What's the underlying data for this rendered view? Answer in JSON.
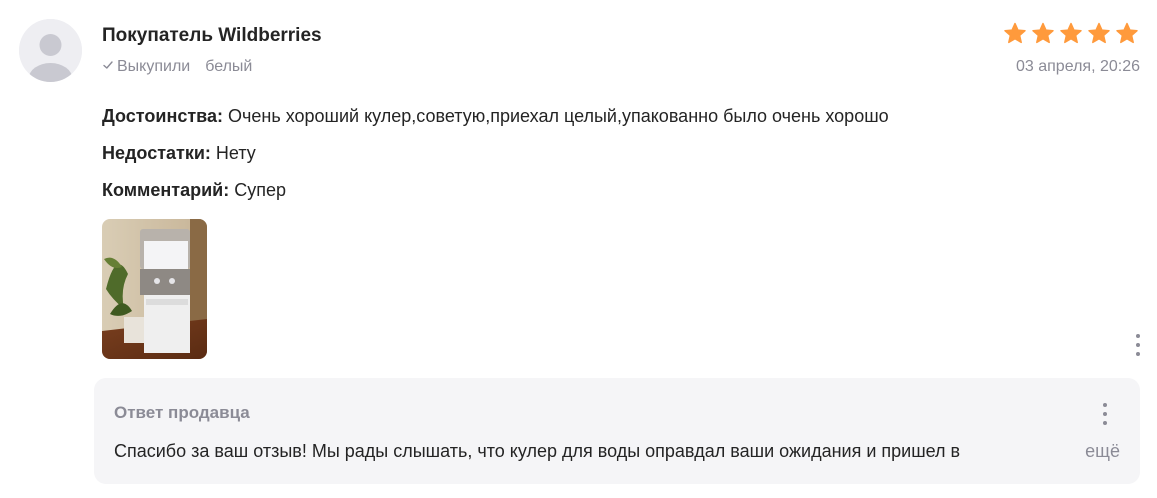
{
  "review": {
    "author": "Покупатель Wildberries",
    "purchase_status": "Выкупили",
    "variant": "белый",
    "date": "03 апреля, 20:26",
    "rating": 5,
    "pros_label": "Достоинства:",
    "pros_text": " Очень хороший кулер,советую,приехал целый,упакованно было очень хорошо",
    "cons_label": "Недостатки:",
    "cons_text": " Нету",
    "comment_label": "Комментарий:",
    "comment_text": " Супер",
    "photo_icon": "review-photo-water-cooler",
    "menu_icon": "more-vertical-icon"
  },
  "seller_answer": {
    "title": "Ответ продавца",
    "text": "Спасибо за ваш отзыв! Мы рады слышать, что кулер для воды оправдал ваши ожидания и пришел в",
    "more_label": "ещё",
    "menu_icon": "more-vertical-icon"
  },
  "colors": {
    "star": "#ff9a3c",
    "muted": "#8b8b96",
    "text": "#242424",
    "answer_bg": "#f5f5f7"
  }
}
